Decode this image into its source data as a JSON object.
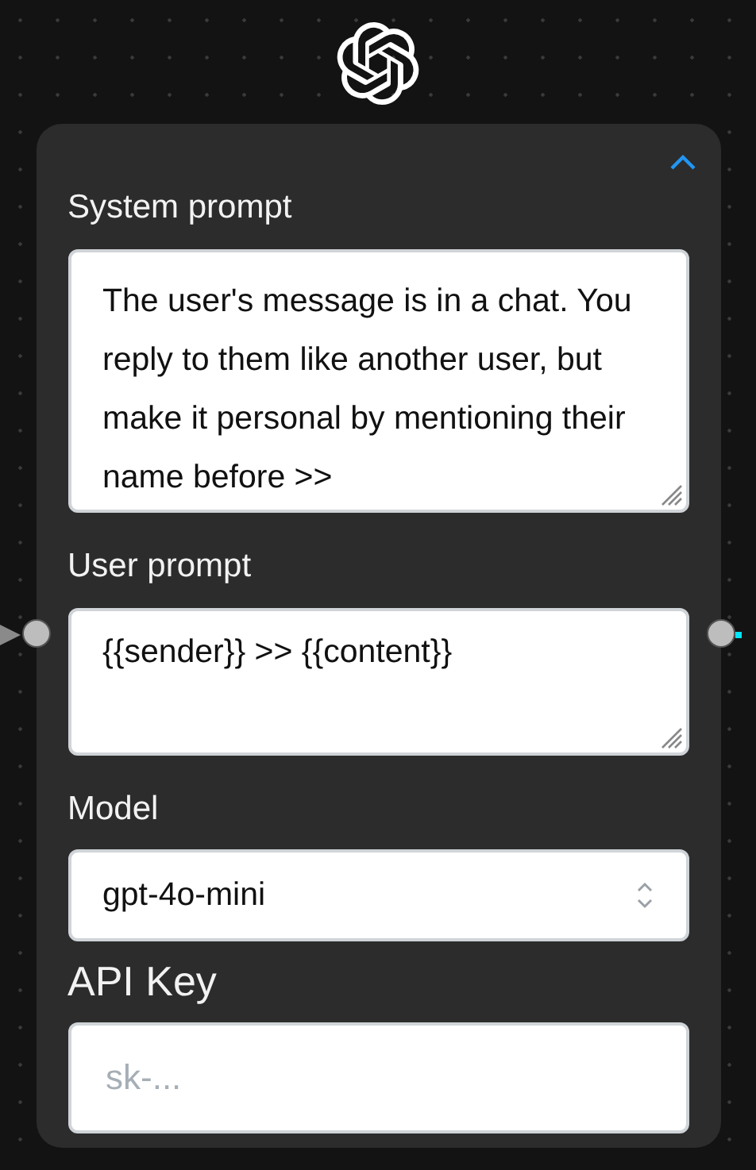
{
  "node": {
    "expanded": true,
    "fields": [
      {
        "kind": "textarea",
        "label": "System prompt",
        "value": "The user's message is in a chat. You reply to them like another user, but make it personal by mentioning their name before >>"
      },
      {
        "kind": "textarea",
        "label": "User prompt",
        "value": "{{sender}} >> {{content}}"
      },
      {
        "kind": "select",
        "label": "Model",
        "value": "gpt-4o-mini"
      },
      {
        "kind": "input",
        "label": "API Key",
        "placeholder": "sk-..."
      }
    ]
  }
}
